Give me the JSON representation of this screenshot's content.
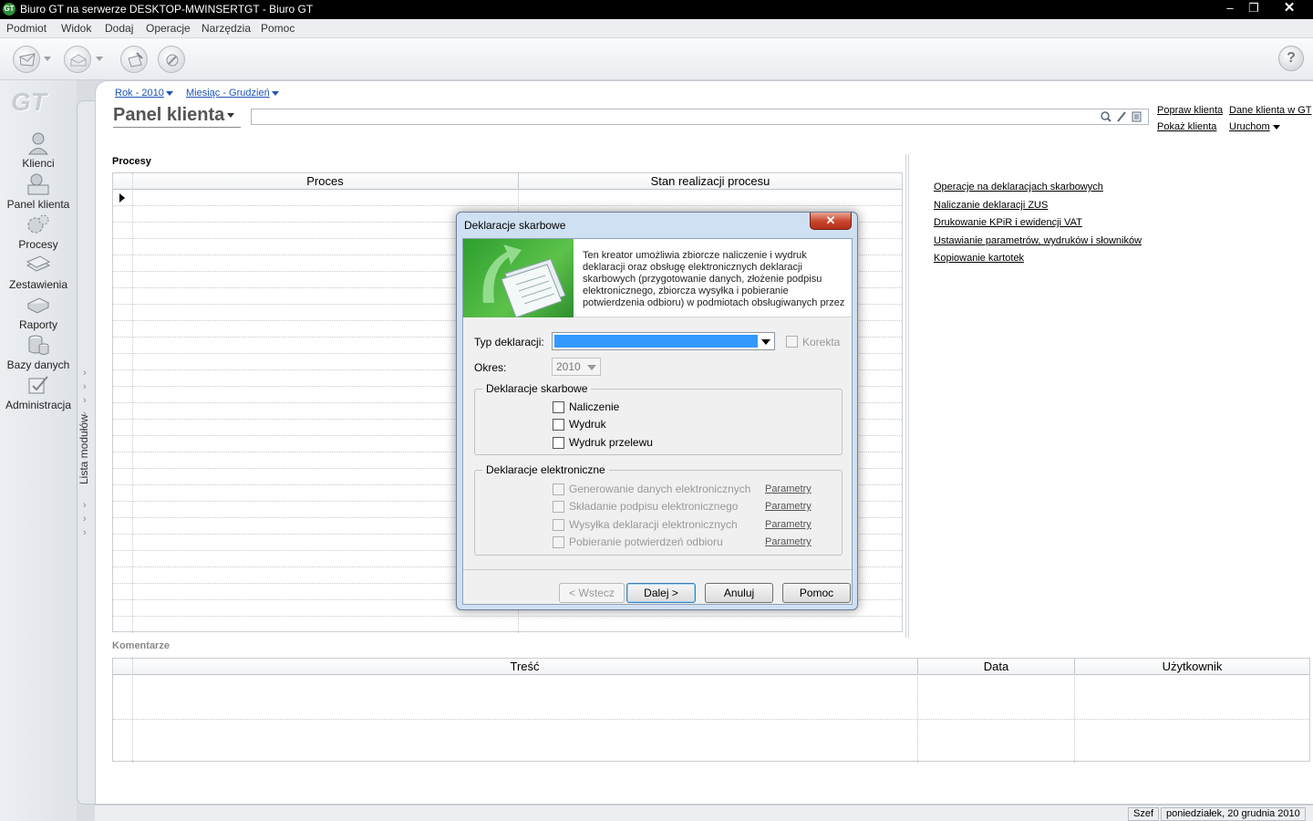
{
  "window": {
    "title": "Biuro GT na serwerze DESKTOP-MWINSERTGT - Biuro GT",
    "app_icon": "GT",
    "min": "‒",
    "max": "❐",
    "close": "✕"
  },
  "menu": [
    "Podmiot",
    "Widok",
    "Dodaj",
    "Operacje",
    "Narzędzia",
    "Pomoc"
  ],
  "sidebar": {
    "logo": "GT",
    "items": [
      {
        "label": "Klienci",
        "icon": "person-icon"
      },
      {
        "label": "Panel klienta",
        "icon": "client-panel-icon"
      },
      {
        "label": "Procesy",
        "icon": "gears-icon"
      },
      {
        "label": "Zestawienia",
        "icon": "sheets-icon"
      },
      {
        "label": "Raporty",
        "icon": "printer-icon"
      },
      {
        "label": "Bazy danych",
        "icon": "database-icon"
      },
      {
        "label": "Administracja",
        "icon": "admin-icon"
      }
    ],
    "modules_label": "Lista modułów"
  },
  "main": {
    "crumbs": [
      "Rok - 2010",
      "Miesiąc - Grudzień"
    ],
    "title": "Panel klienta",
    "links": [
      "Popraw klienta",
      "Dane klienta w GT",
      "Pokaż klienta",
      "Uruchom"
    ],
    "procesy_label": "Procesy",
    "procesy_cols": [
      "Proces",
      "Stan realizacji procesu"
    ],
    "tasks": [
      "Operacje na deklaracjach skarbowych",
      "Naliczanie deklaracji ZUS",
      "Drukowanie KPiR i ewidencji VAT",
      "Ustawianie parametrów, wydruków i słowników",
      "Kopiowanie kartotek"
    ],
    "komentarze_label": "Komentarze",
    "komentarze_cols": [
      "Treść",
      "Data",
      "Użytkownik"
    ]
  },
  "status": {
    "user": "Szef",
    "date": "poniedziałek, 20 grudnia 2010"
  },
  "dialog": {
    "title": "Deklaracje skarbowe",
    "close": "✕",
    "banner_text": "Ten kreator umożliwia zbiorcze naliczenie i wydruk deklaracji oraz obsługę elektronicznych deklaracji skarbowych (przygotowanie danych, złożenie podpisu elektronicznego, zbiorcza wysyłka i pobieranie potwierdzenia odbioru) w podmiotach obsługiwanych przez",
    "typ_label": "Typ deklaracji:",
    "typ_value": "",
    "korekta_label": "Korekta",
    "okres_label": "Okres:",
    "okres_value": "2010",
    "group1_title": "Deklaracje skarbowe",
    "group1_items": [
      "Naliczenie",
      "Wydruk",
      "Wydruk przelewu"
    ],
    "group2_title": "Deklaracje elektroniczne",
    "group2_items": [
      "Generowanie danych elektronicznych",
      "Składanie podpisu elektronicznego",
      "Wysyłka deklaracji elektronicznych",
      "Pobieranie potwierdzeń odbioru"
    ],
    "param_label": "Parametry",
    "buttons": {
      "back": "< Wstecz",
      "next": "Dalej >",
      "cancel": "Anuluj",
      "help": "Pomoc"
    }
  },
  "colors": {
    "selection": "#3399ff",
    "banner_green": "#3aa83a",
    "link_blue": "#1f55b5"
  }
}
